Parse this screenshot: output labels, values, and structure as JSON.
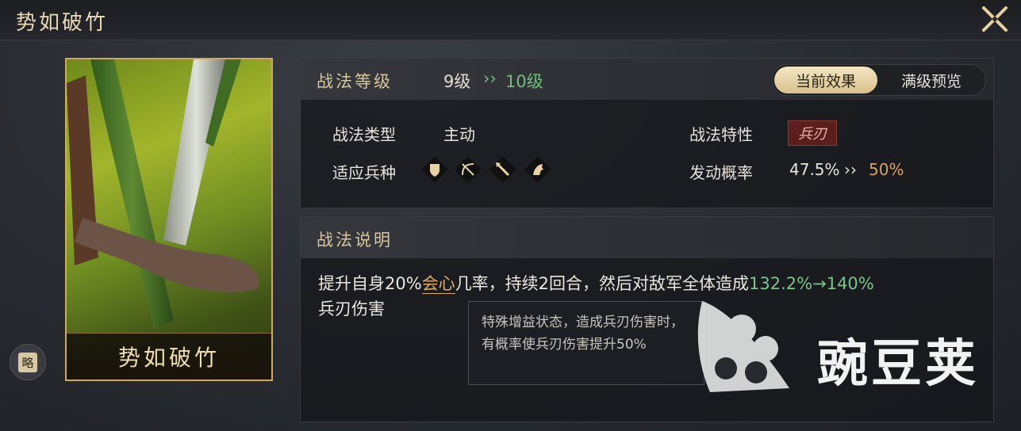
{
  "header": {
    "title": "势如破竹"
  },
  "card": {
    "name": "势如破竹"
  },
  "brief_button": {
    "label": "略"
  },
  "level": {
    "label": "战法等级",
    "current": "9级",
    "arrow": "››",
    "next": "10级"
  },
  "toggle": {
    "current_label": "当前效果",
    "full_label": "满级预览"
  },
  "attributes": {
    "type_label": "战法类型",
    "type_value": "主动",
    "trait_label": "战法特性",
    "trait_value": "兵刃",
    "troops_label": "适应兵种",
    "troops": [
      "shield-icon",
      "bow-icon",
      "spear-icon",
      "horse-icon"
    ],
    "rate_label": "发动概率",
    "rate_current": "47.5%",
    "rate_arrow": "››",
    "rate_next": "50%"
  },
  "description": {
    "label": "战法说明",
    "text_a": "提升自身20%",
    "keyword": "会心",
    "text_b": "几率，持续2回合，然后对敌军全体造成",
    "damage": "132.2%→140%",
    "text_c": "兵刃伤害"
  },
  "tooltip": {
    "text": "特殊增益状态，造成兵刃伤害时，有概率使兵刃伤害提升50%"
  },
  "watermark": {
    "text": "豌豆荚"
  },
  "colors": {
    "accent_gold": "#d9c79d",
    "green": "#7cc487",
    "orange": "#d6a35c"
  }
}
